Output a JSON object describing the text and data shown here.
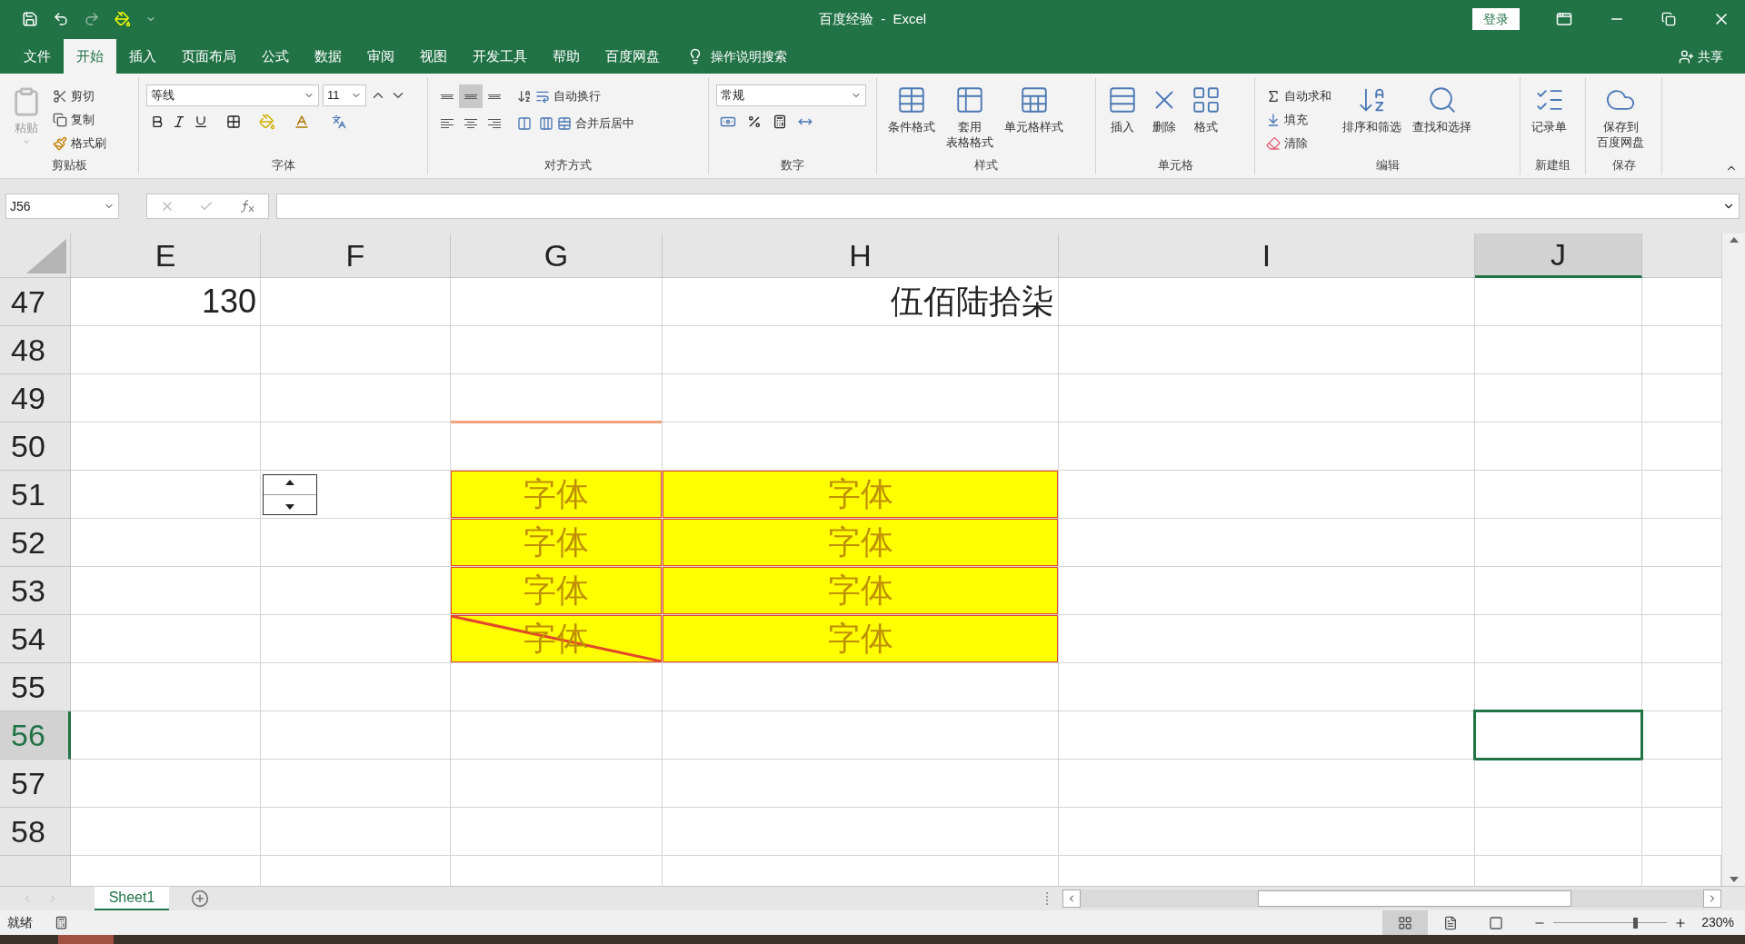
{
  "title_bar": {
    "title": "百度经验  -  Excel",
    "login": "登录"
  },
  "menu_tabs": [
    {
      "label": "文件",
      "selected": false
    },
    {
      "label": "开始",
      "selected": true
    },
    {
      "label": "插入",
      "selected": false
    },
    {
      "label": "页面布局",
      "selected": false
    },
    {
      "label": "公式",
      "selected": false
    },
    {
      "label": "数据",
      "selected": false
    },
    {
      "label": "审阅",
      "selected": false
    },
    {
      "label": "视图",
      "selected": false
    },
    {
      "label": "开发工具",
      "selected": false
    },
    {
      "label": "帮助",
      "selected": false
    },
    {
      "label": "百度网盘",
      "selected": false
    }
  ],
  "tell_me": "操作说明搜索",
  "share": "共享",
  "ribbon": {
    "clipboard": {
      "label": "剪贴板",
      "paste": "粘贴",
      "cut": "剪切",
      "copy": "复制",
      "format_painter": "格式刷"
    },
    "font": {
      "label": "字体",
      "font_name": "等线",
      "font_size": "11"
    },
    "alignment": {
      "label": "对齐方式",
      "vertical_align": [
        {
          "selected": false
        },
        {
          "selected": true
        },
        {
          "selected": false
        }
      ],
      "wrap_text": "自动换行",
      "merge_center": "合并后居中"
    },
    "number": {
      "label": "数字",
      "format": "常规"
    },
    "styles": {
      "label": "样式",
      "buttons": [
        {
          "lines": [
            "条件格式"
          ]
        },
        {
          "lines": [
            "套用",
            "表格格式"
          ]
        },
        {
          "lines": [
            "单元格样式"
          ]
        }
      ]
    },
    "cells": {
      "label": "单元格",
      "buttons": [
        {
          "lines": [
            "插入"
          ]
        },
        {
          "lines": [
            "删除"
          ]
        },
        {
          "lines": [
            "格式"
          ]
        }
      ]
    },
    "editing": {
      "label": "编辑",
      "small": [
        "自动求和",
        "填充",
        "清除"
      ],
      "buttons": [
        {
          "lines": [
            "排序和筛选"
          ]
        },
        {
          "lines": [
            "查找和选择"
          ]
        }
      ]
    },
    "new_group": {
      "label": "新建组",
      "buttons": [
        {
          "lines": [
            "记录单"
          ]
        }
      ]
    },
    "save": {
      "label": "保存",
      "buttons": [
        {
          "lines": [
            "保存到",
            "百度网盘"
          ]
        }
      ]
    }
  },
  "name_box": "J56",
  "columns": [
    {
      "label": "E",
      "selected": false
    },
    {
      "label": "F",
      "selected": false
    },
    {
      "label": "G",
      "selected": false
    },
    {
      "label": "H",
      "selected": false
    },
    {
      "label": "I",
      "selected": false
    },
    {
      "label": "J",
      "selected": true
    }
  ],
  "rows": [
    {
      "header": "47",
      "selected": false,
      "cells": [
        {
          "kind": "number",
          "text": "130"
        },
        null,
        null,
        {
          "kind": "number",
          "text": "伍佰陆拾柒"
        },
        null,
        null
      ]
    },
    {
      "header": "48",
      "selected": false,
      "cells": [
        null,
        null,
        null,
        null,
        null,
        null
      ]
    },
    {
      "header": "49",
      "selected": false,
      "cells": [
        null,
        null,
        {
          "kind": "empty",
          "bottom_border": true
        },
        null,
        null,
        null
      ]
    },
    {
      "header": "50",
      "selected": false,
      "cells": [
        null,
        null,
        null,
        null,
        null,
        null
      ]
    },
    {
      "header": "51",
      "selected": false,
      "cells": [
        null,
        {
          "kind": "spinner"
        },
        {
          "kind": "highlight",
          "text": "字体"
        },
        {
          "kind": "highlight",
          "text": "字体"
        },
        null,
        null
      ]
    },
    {
      "header": "52",
      "selected": false,
      "cells": [
        null,
        null,
        {
          "kind": "highlight",
          "text": "字体"
        },
        {
          "kind": "highlight",
          "text": "字体"
        },
        null,
        null
      ]
    },
    {
      "header": "53",
      "selected": false,
      "cells": [
        null,
        null,
        {
          "kind": "highlight",
          "text": "字体"
        },
        {
          "kind": "highlight",
          "text": "字体"
        },
        null,
        null
      ]
    },
    {
      "header": "54",
      "selected": false,
      "cells": [
        null,
        null,
        {
          "kind": "highlight",
          "text": "字体",
          "diagonal": true
        },
        {
          "kind": "highlight",
          "text": "字体"
        },
        null,
        null
      ]
    },
    {
      "header": "55",
      "selected": false,
      "cells": [
        null,
        null,
        null,
        null,
        null,
        null
      ]
    },
    {
      "header": "56",
      "selected": true,
      "cells": [
        null,
        null,
        null,
        null,
        null,
        {
          "kind": "empty",
          "selected": true
        }
      ]
    },
    {
      "header": "57",
      "selected": false,
      "cells": [
        null,
        null,
        null,
        null,
        null,
        null
      ]
    },
    {
      "header": "58",
      "selected": false,
      "cells": [
        null,
        null,
        null,
        null,
        null,
        null
      ]
    }
  ],
  "sheet_tabs": [
    {
      "label": "Sheet1",
      "selected": true
    }
  ],
  "status_bar": {
    "status": "就绪",
    "zoom": "230%",
    "zoom_slider": {
      "level": 0.72
    }
  }
}
